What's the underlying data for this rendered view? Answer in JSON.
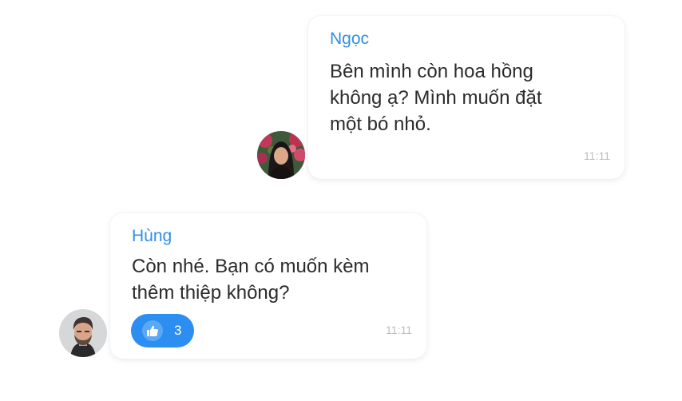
{
  "messages": [
    {
      "sender": "Ngọc",
      "text": "Bên mình còn hoa hồng\nkhông ạ? Mình muốn đặt\nmột bó nhỏ.",
      "time": "11:11",
      "avatar_icon": "woman-avatar"
    },
    {
      "sender": "Hùng",
      "text": "Còn nhé. Bạn có muốn kèm\nthêm thiệp không?",
      "time": "11:11",
      "avatar_icon": "man-avatar",
      "reaction": {
        "icon": "thumbs-up-icon",
        "count": "3"
      }
    }
  ],
  "colors": {
    "sender_name": "#2f8fe8",
    "reaction_bg": "#2b8ef0",
    "timestamp": "#b8bcc4",
    "message_text": "#2b2b2b"
  }
}
